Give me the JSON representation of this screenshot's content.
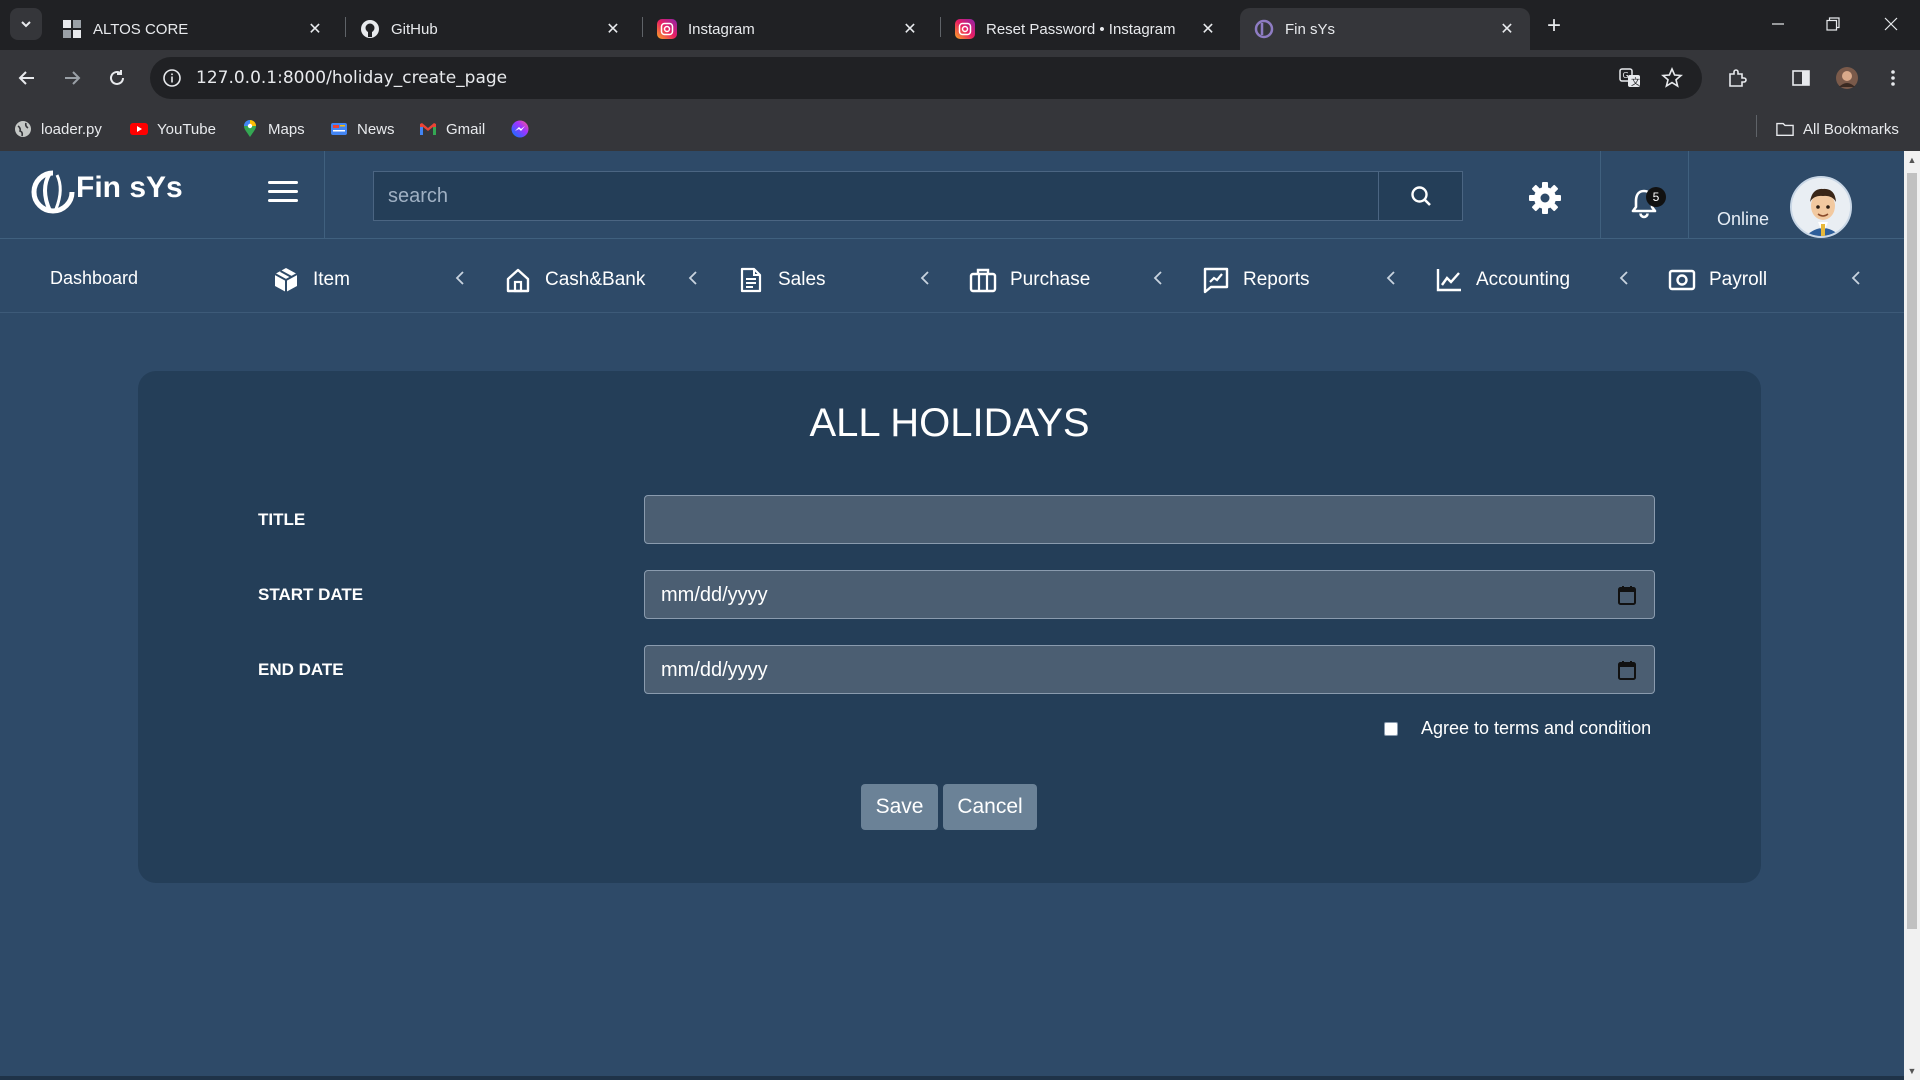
{
  "browser": {
    "tabs": [
      {
        "title": "ALTOS CORE",
        "icon": "grid-icon"
      },
      {
        "title": "GitHub",
        "icon": "github-icon"
      },
      {
        "title": "Instagram",
        "icon": "instagram-icon"
      },
      {
        "title": "Reset Password • Instagram",
        "icon": "instagram-icon"
      },
      {
        "title": "Fin sYs",
        "icon": "finsys-icon"
      }
    ],
    "url": "127.0.0.1:8000/holiday_create_page",
    "bookmarks": [
      {
        "label": "loader.py",
        "icon": "globe-icon"
      },
      {
        "label": "YouTube",
        "icon": "youtube-icon"
      },
      {
        "label": "Maps",
        "icon": "maps-icon"
      },
      {
        "label": "News",
        "icon": "news-icon"
      },
      {
        "label": "Gmail",
        "icon": "gmail-icon"
      },
      {
        "label": "",
        "icon": "messenger-icon"
      }
    ],
    "all_bookmarks": "All Bookmarks"
  },
  "header": {
    "brand": "Fin sYs",
    "search_placeholder": "search",
    "notification_count": "5",
    "status": "Online"
  },
  "nav": {
    "dashboard": "Dashboard",
    "items": [
      {
        "label": "Item",
        "icon": "box-icon"
      },
      {
        "label": "Cash&Bank",
        "icon": "home-icon"
      },
      {
        "label": "Sales",
        "icon": "document-icon"
      },
      {
        "label": "Purchase",
        "icon": "briefcase-icon"
      },
      {
        "label": "Reports",
        "icon": "report-icon"
      },
      {
        "label": "Accounting",
        "icon": "chart-icon"
      },
      {
        "label": "Payroll",
        "icon": "cash-icon"
      }
    ]
  },
  "form": {
    "title": "ALL HOLIDAYS",
    "fields": {
      "title_label": "TITLE",
      "title_value": "",
      "start_label": "START DATE",
      "start_value": "mm/dd/yyyy",
      "end_label": "END DATE",
      "end_value": "mm/dd/yyyy"
    },
    "agree_label": "Agree to terms and condition",
    "save_label": "Save",
    "cancel_label": "Cancel"
  },
  "colors": {
    "page_bg": "#2e4a68",
    "card_bg": "#243e58",
    "input_bg": "#4b5e72",
    "button_bg": "#6b8297"
  }
}
